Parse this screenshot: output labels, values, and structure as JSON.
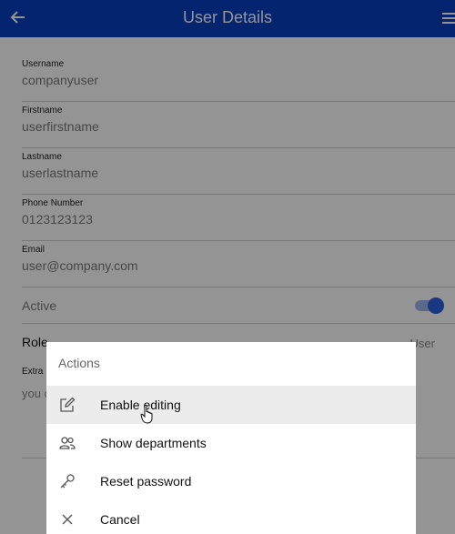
{
  "header": {
    "title": "User Details",
    "back_icon": "arrow-left-icon",
    "menu_icon": "hamburger-menu-icon",
    "color": "#0a3fbf"
  },
  "form": {
    "username": {
      "label": "Username",
      "value": "companyuser"
    },
    "firstname": {
      "label": "Firstname",
      "value": "userfirstname"
    },
    "lastname": {
      "label": "Lastname",
      "value": "userlastname"
    },
    "phone": {
      "label": "Phone Number",
      "value": "0123123123"
    },
    "email": {
      "label": "Email",
      "value": "user@company.com"
    },
    "active": {
      "label": "Active",
      "on": true
    },
    "role": {
      "label": "Role",
      "value": "User"
    },
    "extra": {
      "label": "Extra I",
      "value": "you c"
    }
  },
  "actions": {
    "title": "Actions",
    "items": [
      {
        "label": "Enable editing",
        "icon": "edit-icon"
      },
      {
        "label": "Show departments",
        "icon": "users-icon"
      },
      {
        "label": "Reset password",
        "icon": "key-icon"
      },
      {
        "label": "Cancel",
        "icon": "close-icon"
      }
    ]
  }
}
